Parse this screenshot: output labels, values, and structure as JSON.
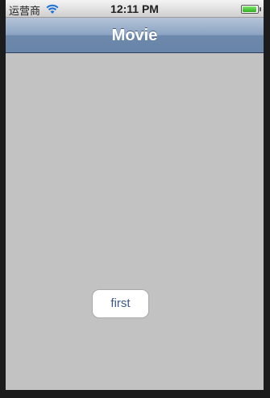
{
  "status_bar": {
    "carrier": "运营商",
    "wifi_icon": "wifi-icon",
    "time": "12:11 PM",
    "battery_icon": "battery-icon"
  },
  "nav_bar": {
    "title": "Movie"
  },
  "content": {
    "button_label": "first"
  }
}
